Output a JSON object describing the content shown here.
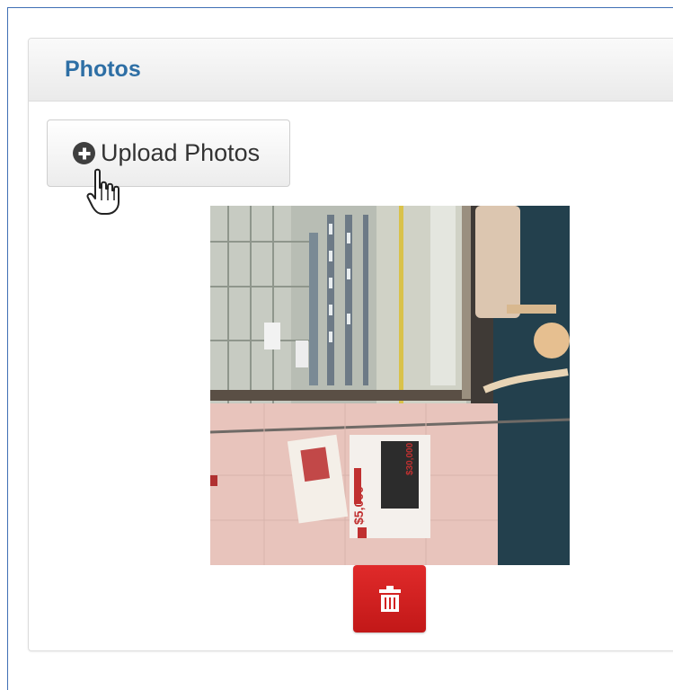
{
  "panel": {
    "title": "Photos"
  },
  "upload_button": {
    "label": "Upload Photos",
    "icon": "plus-circle-icon"
  },
  "cursor": {
    "icon": "hand-pointer-icon"
  },
  "photo": {
    "text": {
      "coupon_left": "$5,000",
      "coupon_right": "$30,000"
    }
  },
  "delete_button": {
    "icon": "trash-icon",
    "color": "#d32020"
  },
  "colors": {
    "title": "#2e6fa5",
    "frame_border": "#3f6fb5"
  }
}
